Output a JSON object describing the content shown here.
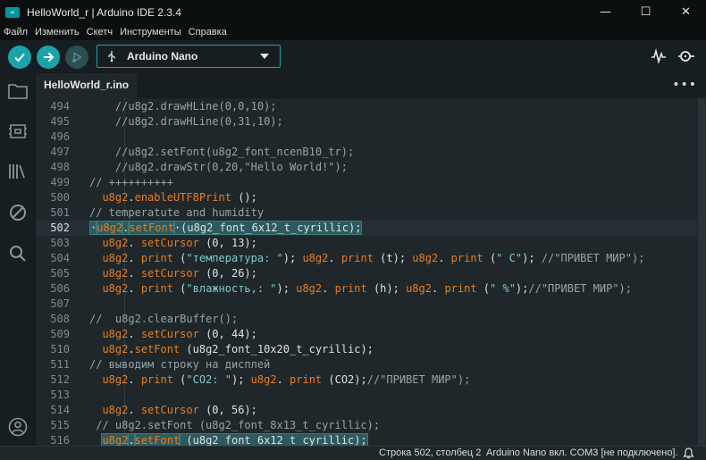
{
  "window": {
    "title": "HelloWorld_r | Arduino IDE 2.3.4",
    "app_icon_text": "∞",
    "minimize_glyph": "—",
    "maximize_glyph": "☐",
    "close_glyph": "✕"
  },
  "menu": [
    "Файл",
    "Изменить",
    "Скетч",
    "Инструменты",
    "Справка"
  ],
  "toolbar": {
    "board": "Arduino Nano",
    "accent_color": "#1aa3ab"
  },
  "tabs": [
    {
      "label": "HelloWorld_r.ino"
    }
  ],
  "tab_more": "•••",
  "editor": {
    "lines": [
      {
        "n": "494",
        "parts": [
          {
            "t": "    //u8g2.drawHLine(0,0,10);",
            "c": "com"
          }
        ]
      },
      {
        "n": "495",
        "parts": [
          {
            "t": "    //u8g2.drawHLine(0,31,10);",
            "c": "com"
          }
        ]
      },
      {
        "n": "496",
        "parts": []
      },
      {
        "n": "497",
        "parts": [
          {
            "t": "    //u8g2.setFont(u8g2_font_ncenB10_tr);",
            "c": "com"
          }
        ]
      },
      {
        "n": "498",
        "parts": [
          {
            "t": "    //u8g2.drawStr(0,20,\"Hello World!\");",
            "c": "com"
          }
        ]
      },
      {
        "n": "499",
        "parts": [
          {
            "t": "// ++++++++++",
            "c": "com"
          }
        ]
      },
      {
        "n": "500",
        "parts": [
          {
            "t": "  ",
            "c": ""
          },
          {
            "t": "u8g2",
            "c": "kw"
          },
          {
            "t": ".",
            "c": ""
          },
          {
            "t": "enableUTF8Print",
            "c": "kw"
          },
          {
            "t": " ();",
            "c": ""
          }
        ]
      },
      {
        "n": "501",
        "parts": [
          {
            "t": "// temperatute and humidity",
            "c": "com"
          }
        ]
      },
      {
        "n": "502",
        "current": true,
        "parts": [
          {
            "t": "·",
            "c": "sel"
          },
          {
            "t": "u8g2",
            "c": "kw sel"
          },
          {
            "t": ".",
            "c": "sel"
          },
          {
            "t": "setFont",
            "c": "kw sel"
          },
          {
            "t": "·(u8g2_font_6x12_t_cyrillic);",
            "c": "sel"
          }
        ]
      },
      {
        "n": "503",
        "parts": [
          {
            "t": "  ",
            "c": ""
          },
          {
            "t": "u8g2",
            "c": "kw"
          },
          {
            "t": ". ",
            "c": ""
          },
          {
            "t": "setCursor",
            "c": "kw"
          },
          {
            "t": " (0, 13);",
            "c": ""
          }
        ]
      },
      {
        "n": "504",
        "parts": [
          {
            "t": "  ",
            "c": ""
          },
          {
            "t": "u8g2",
            "c": "kw"
          },
          {
            "t": ". ",
            "c": ""
          },
          {
            "t": "print",
            "c": "kw"
          },
          {
            "t": " (",
            "c": ""
          },
          {
            "t": "\"температура: \"",
            "c": "str"
          },
          {
            "t": "); ",
            "c": ""
          },
          {
            "t": "u8g2",
            "c": "kw"
          },
          {
            "t": ". ",
            "c": ""
          },
          {
            "t": "print",
            "c": "kw"
          },
          {
            "t": " (t); ",
            "c": ""
          },
          {
            "t": "u8g2",
            "c": "kw"
          },
          {
            "t": ". ",
            "c": ""
          },
          {
            "t": "print",
            "c": "kw"
          },
          {
            "t": " (",
            "c": ""
          },
          {
            "t": "\" C\"",
            "c": "str"
          },
          {
            "t": "); ",
            "c": ""
          },
          {
            "t": "//\"ПРИВЕТ МИР\");",
            "c": "com"
          }
        ]
      },
      {
        "n": "505",
        "parts": [
          {
            "t": "  ",
            "c": ""
          },
          {
            "t": "u8g2",
            "c": "kw"
          },
          {
            "t": ". ",
            "c": ""
          },
          {
            "t": "setCursor",
            "c": "kw"
          },
          {
            "t": " (0, 26);",
            "c": ""
          }
        ]
      },
      {
        "n": "506",
        "parts": [
          {
            "t": "  ",
            "c": ""
          },
          {
            "t": "u8g2",
            "c": "kw"
          },
          {
            "t": ". ",
            "c": ""
          },
          {
            "t": "print",
            "c": "kw"
          },
          {
            "t": " (",
            "c": ""
          },
          {
            "t": "\"влажность,: \"",
            "c": "str"
          },
          {
            "t": "); ",
            "c": ""
          },
          {
            "t": "u8g2",
            "c": "kw"
          },
          {
            "t": ". ",
            "c": ""
          },
          {
            "t": "print",
            "c": "kw"
          },
          {
            "t": " (h); ",
            "c": ""
          },
          {
            "t": "u8g2",
            "c": "kw"
          },
          {
            "t": ". ",
            "c": ""
          },
          {
            "t": "print",
            "c": "kw"
          },
          {
            "t": " (",
            "c": ""
          },
          {
            "t": "\" %\"",
            "c": "str"
          },
          {
            "t": ");",
            "c": ""
          },
          {
            "t": "//\"ПРИВЕТ МИР\");",
            "c": "com"
          }
        ]
      },
      {
        "n": "507",
        "parts": []
      },
      {
        "n": "508",
        "parts": [
          {
            "t": "//  u8g2.clearBuffer();",
            "c": "com"
          }
        ]
      },
      {
        "n": "509",
        "parts": [
          {
            "t": "  ",
            "c": ""
          },
          {
            "t": "u8g2",
            "c": "kw"
          },
          {
            "t": ". ",
            "c": ""
          },
          {
            "t": "setCursor",
            "c": "kw"
          },
          {
            "t": " (0, 44);",
            "c": ""
          }
        ]
      },
      {
        "n": "510",
        "parts": [
          {
            "t": "  ",
            "c": ""
          },
          {
            "t": "u8g2",
            "c": "kw"
          },
          {
            "t": ".",
            "c": ""
          },
          {
            "t": "setFont",
            "c": "kw"
          },
          {
            "t": " (u8g2_font_10x20_t_cyrillic);",
            "c": ""
          }
        ]
      },
      {
        "n": "511",
        "parts": [
          {
            "t": "// выводим строку на дисплей",
            "c": "com"
          }
        ]
      },
      {
        "n": "512",
        "parts": [
          {
            "t": "  ",
            "c": ""
          },
          {
            "t": "u8g2",
            "c": "kw"
          },
          {
            "t": ". ",
            "c": ""
          },
          {
            "t": "print",
            "c": "kw"
          },
          {
            "t": " (",
            "c": ""
          },
          {
            "t": "\"CO2: \"",
            "c": "str"
          },
          {
            "t": "); ",
            "c": ""
          },
          {
            "t": "u8g2",
            "c": "kw"
          },
          {
            "t": ". ",
            "c": ""
          },
          {
            "t": "print",
            "c": "kw"
          },
          {
            "t": " (CO2);",
            "c": ""
          },
          {
            "t": "//\"ПРИВЕТ МИР\");",
            "c": "com"
          }
        ]
      },
      {
        "n": "513",
        "parts": []
      },
      {
        "n": "514",
        "parts": [
          {
            "t": "  ",
            "c": ""
          },
          {
            "t": "u8g2",
            "c": "kw"
          },
          {
            "t": ". ",
            "c": ""
          },
          {
            "t": "setCursor",
            "c": "kw"
          },
          {
            "t": " (0, 56);",
            "c": ""
          }
        ]
      },
      {
        "n": "515",
        "parts": [
          {
            "t": " // u8g2.setFont (u8g2_font_8x13_t_cyrillic);",
            "c": "com"
          }
        ]
      },
      {
        "n": "516",
        "parts": [
          {
            "t": "  ",
            "c": ""
          },
          {
            "t": "u8g2",
            "c": "kw sel"
          },
          {
            "t": ".",
            "c": "sel"
          },
          {
            "t": "setFont",
            "c": "kw sel"
          },
          {
            "t": " (u8g2_font_6x12_t_cyrillic);",
            "c": "sel"
          }
        ]
      }
    ]
  },
  "status": {
    "position": "Строка 502, столбец 2",
    "board": "Arduino Nano вкл. COM3 [не подключено]."
  }
}
